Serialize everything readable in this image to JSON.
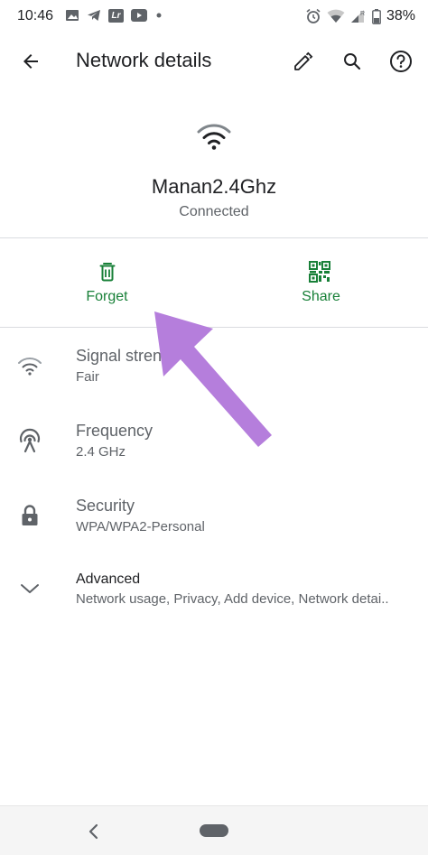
{
  "status_bar": {
    "time": "10:46",
    "battery": "38%",
    "left_icons": [
      "image-icon",
      "telegram-icon",
      "lightroom-icon",
      "youtube-icon",
      "dot-icon"
    ],
    "right_icons": [
      "alarm-icon",
      "wifi-icon",
      "signal-icon",
      "battery-icon"
    ],
    "lightroom_text": "Lr"
  },
  "app_bar": {
    "title": "Network details",
    "actions": [
      "edit-icon",
      "search-icon",
      "help-icon"
    ]
  },
  "network": {
    "name": "Manan2.4Ghz",
    "status": "Connected"
  },
  "actions": {
    "forget": "Forget",
    "share": "Share"
  },
  "details": [
    {
      "title": "Signal strength",
      "value": "Fair",
      "icon": "wifi-signal-icon"
    },
    {
      "title": "Frequency",
      "value": "2.4 GHz",
      "icon": "antenna-icon"
    },
    {
      "title": "Security",
      "value": "WPA/WPA2-Personal",
      "icon": "lock-icon"
    },
    {
      "title": "Advanced",
      "value": "Network usage, Privacy, Add device, Network detai..",
      "icon": "chevron-down-icon"
    }
  ],
  "colors": {
    "accent_green": "#188038",
    "annotation_purple": "#b57edc"
  }
}
